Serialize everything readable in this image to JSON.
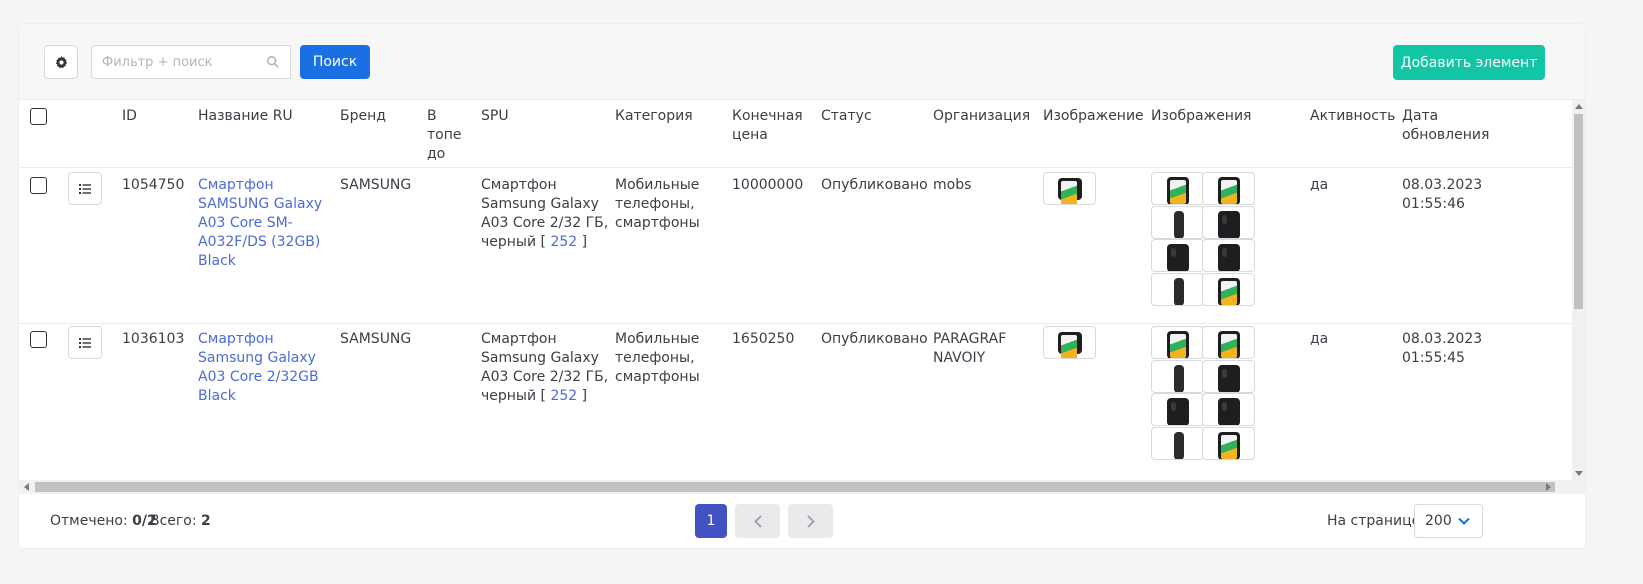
{
  "toolbar": {
    "search_placeholder": "Фильтр + поиск",
    "search_button": "Поиск",
    "add_button": "Добавить элемент"
  },
  "columns": {
    "id": "ID",
    "name": "Название RU",
    "brand": "Бренд",
    "top": [
      "В",
      "топе",
      "до"
    ],
    "spu": "SPU",
    "category": "Категория",
    "price": [
      "Конечная",
      "цена"
    ],
    "status": "Статус",
    "org": "Организация",
    "image": "Изображение",
    "images": "Изображения",
    "active": "Активность",
    "updated": [
      "Дата",
      "обновления"
    ]
  },
  "rows": [
    {
      "id": "1054750",
      "name": [
        "Смартфон",
        "SAMSUNG Galaxy",
        "A03 Core SM-",
        "A032F/DS (32GB)",
        "Black"
      ],
      "brand": "SAMSUNG",
      "spu": [
        "Смартфон",
        "Samsung Galaxy",
        "A03 Core 2/32 ГБ,",
        "черный"
      ],
      "spu_link": "252",
      "category": [
        "Мобильные",
        "телефоны,",
        "смартфоны"
      ],
      "price": "10000000",
      "status": "Опубликовано",
      "org": [
        "mobs"
      ],
      "active": "да",
      "updated": [
        "08.03.2023",
        "01:55:46"
      ]
    },
    {
      "id": "1036103",
      "name": [
        "Смартфон",
        "Samsung Galaxy",
        "A03 Core 2/32GB",
        "Black"
      ],
      "brand": "SAMSUNG",
      "spu": [
        "Смартфон",
        "Samsung Galaxy",
        "A03 Core 2/32 ГБ,",
        "черный"
      ],
      "spu_link": "252",
      "category": [
        "Мобильные",
        "телефоны,",
        "смартфоны"
      ],
      "price": "1650250",
      "status": "Опубликовано",
      "org": [
        "PARAGRAF",
        "NAVOIY"
      ],
      "active": "да",
      "updated": [
        "08.03.2023",
        "01:55:45"
      ]
    }
  ],
  "footer": {
    "selected_label": "Отмечено:",
    "selected_value": "0/2",
    "total_label": "Всего:",
    "total_value": "2",
    "page": "1",
    "per_page_label": "На странице",
    "per_page_value": "200"
  },
  "colors": {
    "search_button": "#1b6fe4",
    "add_button": "#12c6a5",
    "active_page": "#4152c4",
    "link": "#4d6bd5"
  }
}
